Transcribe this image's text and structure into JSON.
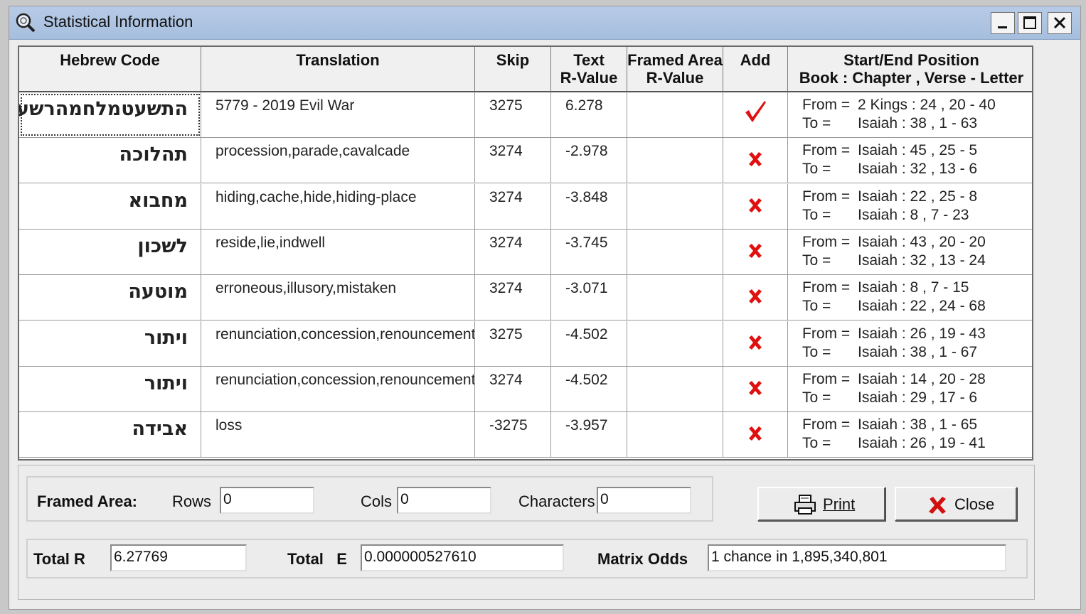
{
  "window": {
    "title": "Statistical Information"
  },
  "table": {
    "headers": {
      "hebrew": "Hebrew Code",
      "translation": "Translation",
      "skip": "Skip",
      "text_r": [
        "Text",
        "R-Value"
      ],
      "framed_r": [
        "Framed Area",
        "R-Value"
      ],
      "add": "Add",
      "position": [
        "Start/End Position",
        "Book : Chapter , Verse - Letter"
      ]
    },
    "rows": [
      {
        "hebrew": "התשעטמלחמהרשע",
        "translation": "5779 - 2019 Evil War",
        "skip": "3275",
        "text_r": "6.278",
        "framed_r": "",
        "added": true,
        "from_label": "From =",
        "from": "2 Kings : 24 , 20 - 40",
        "to_label": "To =",
        "to": "Isaiah : 38 , 1 - 63"
      },
      {
        "hebrew": "תהלוכה",
        "translation": "procession,parade,cavalcade",
        "skip": "3274",
        "text_r": "-2.978",
        "framed_r": "",
        "added": false,
        "from_label": "From =",
        "from": "Isaiah : 45 , 25 - 5",
        "to_label": "To =",
        "to": "Isaiah : 32 , 13 - 6"
      },
      {
        "hebrew": "מחבוא",
        "translation": "hiding,cache,hide,hiding-place",
        "skip": "3274",
        "text_r": "-3.848",
        "framed_r": "",
        "added": false,
        "from_label": "From =",
        "from": "Isaiah : 22 , 25 - 8",
        "to_label": "To =",
        "to": "Isaiah : 8 , 7 - 23"
      },
      {
        "hebrew": "לשכון",
        "translation": "reside,lie,indwell",
        "skip": "3274",
        "text_r": "-3.745",
        "framed_r": "",
        "added": false,
        "from_label": "From =",
        "from": "Isaiah : 43 , 20 - 20",
        "to_label": "To =",
        "to": "Isaiah : 32 , 13 - 24"
      },
      {
        "hebrew": "מוטעה",
        "translation": "erroneous,illusory,mistaken",
        "skip": "3274",
        "text_r": "-3.071",
        "framed_r": "",
        "added": false,
        "from_label": "From =",
        "from": "Isaiah : 8 , 7 - 15",
        "to_label": "To =",
        "to": "Isaiah : 22 , 24 - 68"
      },
      {
        "hebrew": "ויתור",
        "translation": "renunciation,concession,renouncement",
        "skip": "3275",
        "text_r": "-4.502",
        "framed_r": "",
        "added": false,
        "from_label": "From =",
        "from": "Isaiah : 26 , 19 - 43",
        "to_label": "To =",
        "to": "Isaiah : 38 , 1 - 67"
      },
      {
        "hebrew": "ויתור",
        "translation": "renunciation,concession,renouncement",
        "skip": "3274",
        "text_r": "-4.502",
        "framed_r": "",
        "added": false,
        "from_label": "From =",
        "from": "Isaiah : 14 , 20 - 28",
        "to_label": "To =",
        "to": "Isaiah : 29 , 17 - 6"
      },
      {
        "hebrew": "אבידה",
        "translation": "loss",
        "skip": "-3275",
        "text_r": "-3.957",
        "framed_r": "",
        "added": false,
        "from_label": "From =",
        "from": "Isaiah : 38 , 1 - 65",
        "to_label": "To =",
        "to": "Isaiah : 26 , 19 - 41"
      }
    ]
  },
  "framed_area": {
    "label": "Framed Area:",
    "rows_label": "Rows",
    "rows_value": "0",
    "cols_label": "Cols",
    "cols_value": "0",
    "chars_label": "Characters",
    "chars_value": "0"
  },
  "totals": {
    "total_r_label": "Total R",
    "total_r_value": "6.27769",
    "total_e_label1": "Total",
    "total_e_label2": "E",
    "total_e_value": "0.000000527610",
    "odds_label": "Matrix Odds",
    "odds_value": "1 chance in 1,895,340,801"
  },
  "buttons": {
    "print": "Print",
    "close": "Close"
  },
  "colors": {
    "check": "#e01010",
    "cross": "#e01010",
    "titlebar": "#b0c6e2"
  }
}
